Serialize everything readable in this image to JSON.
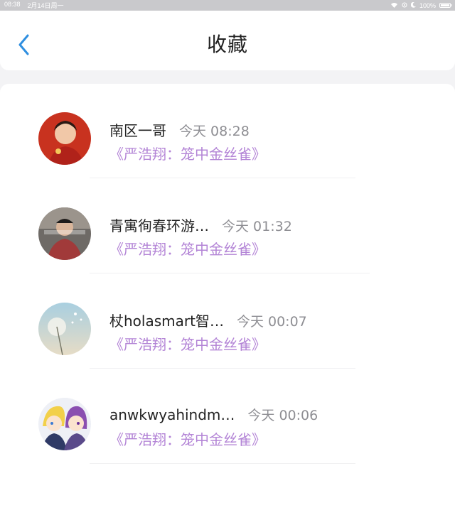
{
  "status_bar": {
    "time": "08:38",
    "date": "2月14日周一",
    "battery": "100%"
  },
  "header": {
    "title": "收藏"
  },
  "favorites": [
    {
      "name": "南区一哥",
      "time": "今天 08:28",
      "link": "《严浩翔：笼中金丝雀》"
    },
    {
      "name": "青寓徇春环游…",
      "time": "今天 01:32",
      "link": "《严浩翔：笼中金丝雀》"
    },
    {
      "name": "杖holasmart智…",
      "time": "今天 00:07",
      "link": "《严浩翔：笼中金丝雀》"
    },
    {
      "name": "anwkwyahindm…",
      "time": "今天 00:06",
      "link": "《严浩翔：笼中金丝雀》"
    }
  ],
  "colors": {
    "accent": "#2f8fe0",
    "link": "#b384d6"
  }
}
